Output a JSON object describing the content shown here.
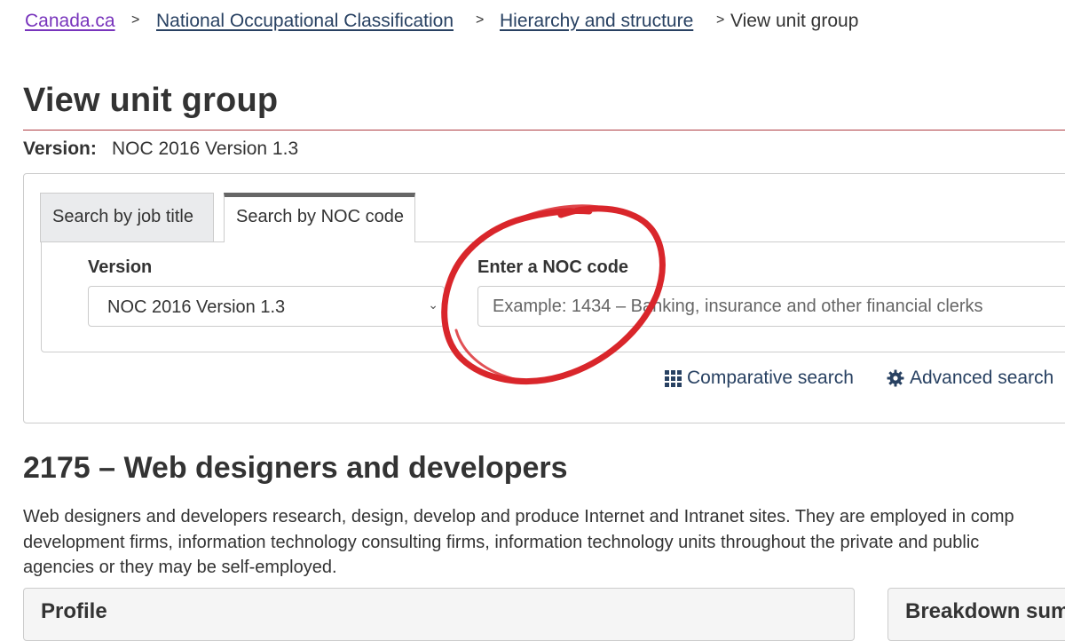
{
  "breadcrumb": {
    "items": [
      {
        "label": "Canada.ca"
      },
      {
        "label": "National Occupational Classification"
      },
      {
        "label": "Hierarchy and structure"
      },
      {
        "label": "View unit group"
      }
    ],
    "separator": ">"
  },
  "page": {
    "title": "View unit group",
    "version_label": "Version:",
    "version_value": "NOC 2016 Version 1.3"
  },
  "search": {
    "tabs": [
      {
        "label": "Search by job title",
        "active": false
      },
      {
        "label": "Search by NOC code",
        "active": true
      }
    ],
    "version_field_label": "Version",
    "version_selected": "NOC 2016 Version 1.3",
    "noc_field_label": "Enter a NOC code",
    "noc_placeholder": "Example: 1434 – Banking, insurance and other financial clerks",
    "noc_value": "",
    "comparative_link": "Comparative search",
    "advanced_link": "Advanced search"
  },
  "unit_group": {
    "title": "2175 – Web designers and developers",
    "description_lines": [
      "Web designers and developers research, design, develop and produce Internet and Intranet sites. They are employed in comp",
      "development firms, information technology consulting firms, information technology units throughout the private and public",
      "agencies or they may be self-employed."
    ]
  },
  "cards": {
    "profile_title": "Profile",
    "breakdown_title": "Breakdown summ"
  },
  "colors": {
    "link": "#284162",
    "visited_link": "#7834bc",
    "title_rule": "#af3c43",
    "annotation_red": "#d9262b"
  },
  "icons": {
    "comparative": "grid-icon",
    "advanced": "gear-icon",
    "select": "chevron-down-icon"
  }
}
